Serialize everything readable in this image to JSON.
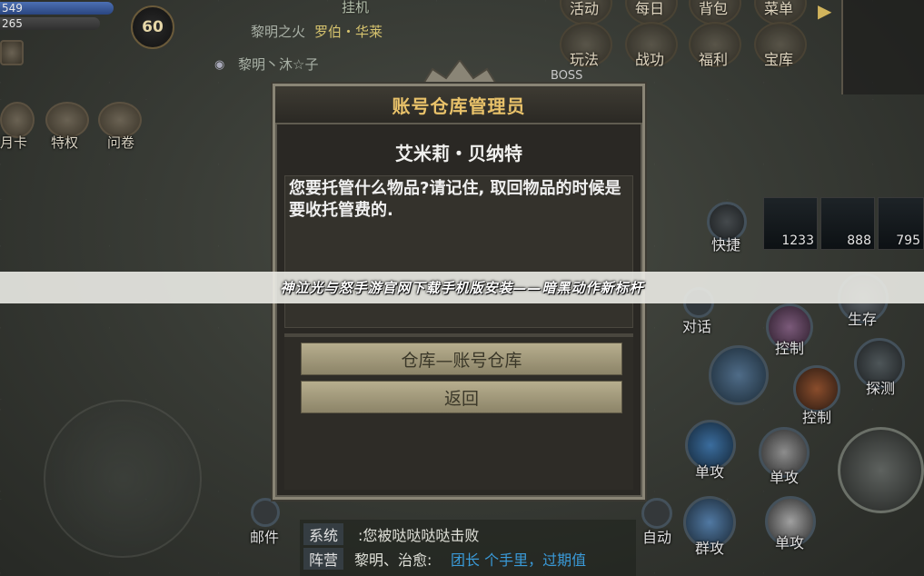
{
  "hud": {
    "hp_value": "549",
    "mp_value": "265",
    "level": "60",
    "hp_color": "#3a5ea0"
  },
  "world": {
    "skill_label_top": "挂机",
    "guild_name": "黎明之火",
    "player_title": "罗伯・华莱",
    "player_name_2": "黎明丶沐☆子",
    "boss_tag": "BOSS"
  },
  "left_menu": [
    {
      "label": "月卡",
      "icon": "calendar-icon"
    },
    {
      "label": "特权",
      "icon": "crown-icon"
    },
    {
      "label": "问卷",
      "icon": "questionnaire-icon"
    }
  ],
  "top_menu": [
    {
      "label": "活动",
      "icon": "activity-icon"
    },
    {
      "label": "每日",
      "icon": "daily-icon"
    },
    {
      "label": "背包",
      "icon": "bag-icon"
    },
    {
      "label": "菜单",
      "icon": "menu-icon"
    },
    {
      "label": "玩法",
      "icon": "gameplay-icon"
    },
    {
      "label": "战功",
      "icon": "merit-icon"
    },
    {
      "label": "福利",
      "icon": "welfare-icon"
    },
    {
      "label": "宝库",
      "icon": "treasure-icon"
    }
  ],
  "quick_slots": [
    {
      "label": "快捷",
      "count": ""
    },
    {
      "label": "",
      "count": "1233"
    },
    {
      "label": "",
      "count": "888"
    },
    {
      "label": "",
      "count": "795"
    }
  ],
  "skills": {
    "dialog_label": "对话",
    "control_1": "控制",
    "control_2": "控制",
    "survive": "生存",
    "detect": "探测",
    "single_1": "单攻",
    "single_2": "单攻",
    "single_3": "单攻",
    "group": "群攻",
    "auto": "自动",
    "mail": "邮件"
  },
  "chat": {
    "channel_system": "系统",
    "system_msg": ":您被哒哒哒哒击败",
    "channel_camp": "阵营",
    "camp_sender": "黎明、治愈:",
    "camp_msg": "团长 个手里，过期值"
  },
  "dialog": {
    "title": "账号仓库管理员",
    "npc_name": "艾米莉・贝纳特",
    "npc_text": "您要托管什么物品?请记住, 取回物品的时候是要收托管费的.",
    "option_1": "仓库—账号仓库",
    "option_2": "返回",
    "title_color": "#e9c26a"
  },
  "banner": {
    "text": "神泣光与怒手游官网下载手机版安装——暗黑动作新标杆"
  }
}
